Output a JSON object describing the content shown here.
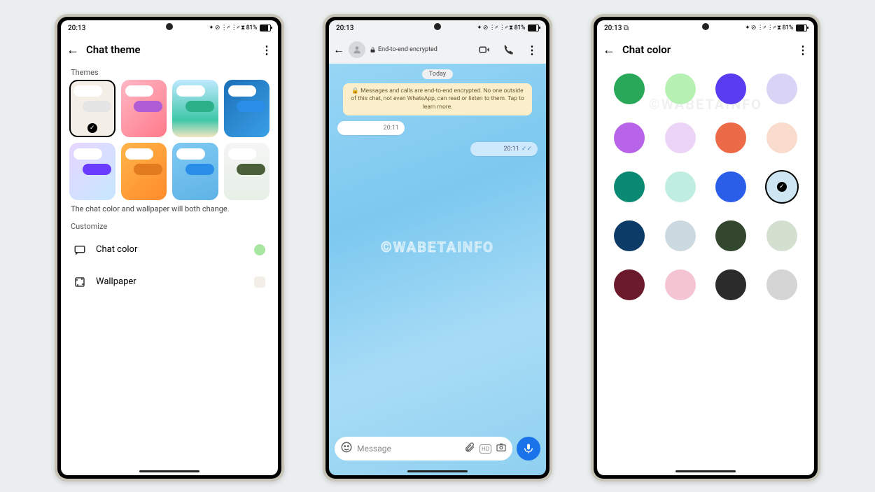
{
  "status": {
    "time": "20:13",
    "time_icon_variant": "20:13 ⧉",
    "battery_pct": "81%",
    "indicators": "✦ ⊘ ⋮𝄎 ⋮𝄎 ⧗"
  },
  "watermark": "©WABETAINFO",
  "screen1": {
    "title": "Chat theme",
    "section_themes": "Themes",
    "desc": "The chat color and wallpaper will both change.",
    "section_customize": "Customize",
    "row_chat_color": "Chat color",
    "row_wallpaper": "Wallpaper",
    "chat_color_swatch": "#a8e6a1",
    "wallpaper_swatch": "#f3efe6",
    "themes": [
      {
        "bg": "bg-default",
        "out": "out-grey",
        "selected": true
      },
      {
        "bg": "bg-pink",
        "out": "out-pink",
        "selected": false
      },
      {
        "bg": "bg-sea",
        "out": "out-teal",
        "selected": false
      },
      {
        "bg": "bg-deepblue",
        "out": "out-blue",
        "selected": false
      },
      {
        "bg": "bg-pastel",
        "out": "out-violet",
        "selected": false
      },
      {
        "bg": "bg-orange",
        "out": "out-orange",
        "selected": false
      },
      {
        "bg": "bg-sky",
        "out": "out-cyan",
        "selected": false
      },
      {
        "bg": "bg-white",
        "out": "out-olive",
        "selected": false
      }
    ]
  },
  "screen2": {
    "encrypted_label": "End-to-end encrypted",
    "date_pill": "Today",
    "banner": "Messages and calls are end-to-end encrypted. No one outside of this chat, not even WhatsApp, can read or listen to them. Tap to learn more.",
    "msg_in_time": "20:11",
    "msg_out_time": "20:11",
    "compose_placeholder": "Message"
  },
  "screen3": {
    "title": "Chat color",
    "colors": [
      {
        "hex": "#2aa85a",
        "sel": false
      },
      {
        "hex": "#b6f0b2",
        "sel": false
      },
      {
        "hex": "#5a3cf0",
        "sel": false
      },
      {
        "hex": "#d9d3f6",
        "sel": false
      },
      {
        "hex": "#b864e8",
        "sel": false
      },
      {
        "hex": "#ecd4f6",
        "sel": false
      },
      {
        "hex": "#ec6a48",
        "sel": false
      },
      {
        "hex": "#f9dcce",
        "sel": false
      },
      {
        "hex": "#0b8a73",
        "sel": false
      },
      {
        "hex": "#bfeee1",
        "sel": false
      },
      {
        "hex": "#2a5de8",
        "sel": false
      },
      {
        "hex": "#cde6f2",
        "sel": true
      },
      {
        "hex": "#0b3b66",
        "sel": false
      },
      {
        "hex": "#cdd9e0",
        "sel": false
      },
      {
        "hex": "#33472f",
        "sel": false
      },
      {
        "hex": "#d3e0d0",
        "sel": false
      },
      {
        "hex": "#6b1a2c",
        "sel": false
      },
      {
        "hex": "#f4c4d2",
        "sel": false
      },
      {
        "hex": "#2b2b2b",
        "sel": false
      },
      {
        "hex": "#d5d5d5",
        "sel": false
      }
    ]
  }
}
